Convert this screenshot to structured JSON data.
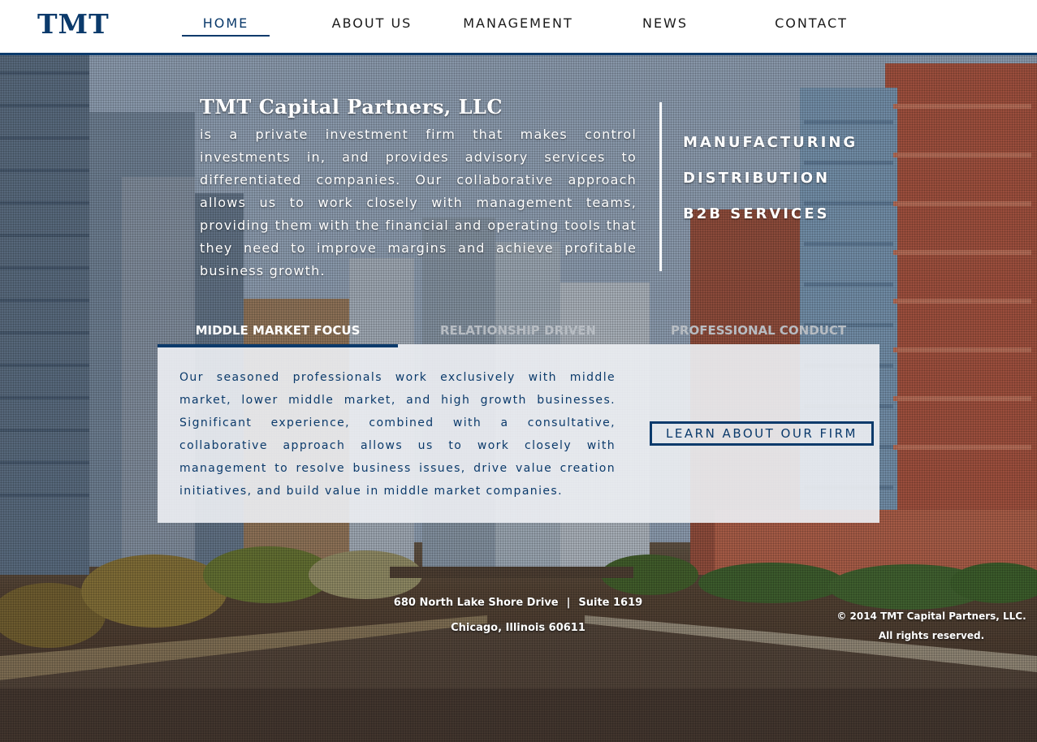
{
  "header": {
    "logo": "TMT",
    "nav": [
      {
        "label": "HOME",
        "active": true
      },
      {
        "label": "ABOUT US",
        "active": false
      },
      {
        "label": "MANAGEMENT",
        "active": false
      },
      {
        "label": "NEWS",
        "active": false
      },
      {
        "label": "CONTACT",
        "active": false
      }
    ]
  },
  "intro": {
    "company_name": "TMT Capital Partners, LLC",
    "description": "is a private investment firm that makes control investments in, and provides advisory services to differentiated companies. Our collaborative approach allows us to work closely with management teams, providing them with the financial and operating tools that they need to improve margins and achieve profitable business growth."
  },
  "sectors": [
    "MANUFACTURING",
    "DISTRIBUTION",
    "B2B SERVICES"
  ],
  "tabs": [
    {
      "label": "MIDDLE MARKET FOCUS",
      "active": true
    },
    {
      "label": "RELATIONSHIP DRIVEN",
      "active": false
    },
    {
      "label": "PROFESSIONAL CONDUCT",
      "active": false
    }
  ],
  "panel": {
    "text": "Our seasoned professionals work exclusively with middle market, lower middle market, and high growth businesses. Significant experience, combined with a consultative, collaborative approach allows us to work closely with management to resolve business issues, drive value creation initiatives, and build value in middle market companies.",
    "button_label": "LEARN ABOUT OUR FIRM"
  },
  "footer": {
    "street": "680 North Lake Shore Drive",
    "separator": "|",
    "suite": "Suite 1619",
    "city": "Chicago, Illinois 60611",
    "copyright_line1": "© 2014 TMT Capital Partners, LLC.",
    "copyright_line2": "All rights reserved."
  },
  "colors": {
    "brand_navy": "#0b3a6b",
    "text_white": "#ffffff",
    "tab_inactive": "#b7bcc2",
    "panel_bg": "#eceef2"
  }
}
